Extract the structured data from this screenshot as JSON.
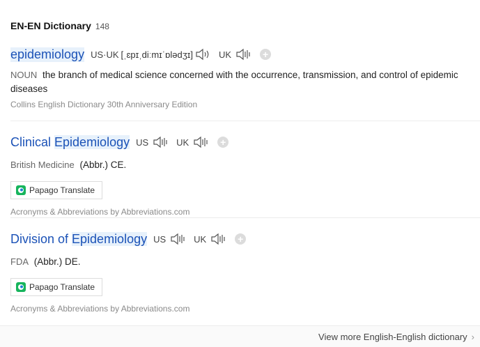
{
  "header": {
    "title": "EN-EN Dictionary",
    "count": "148"
  },
  "entries": [
    {
      "word": "epidemiology",
      "pron": [
        {
          "label": "US·UK",
          "ipa": "[ˌɛpɪˌdiːmɪˈɒlədʒɪ]"
        },
        {
          "label": "UK",
          "ipa": ""
        }
      ],
      "pos": "NOUN",
      "definition": "the branch of medical science concerned with the occurrence, transmission, and control of epidemic diseases",
      "source": "Collins English Dictionary 30th Anniversary Edition"
    },
    {
      "word_plain": "Clinical ",
      "word_highlight": "Epidemiology",
      "pron": [
        {
          "label": "US"
        },
        {
          "label": "UK"
        }
      ],
      "domain": "British Medicine",
      "abbr": "(Abbr.) CE.",
      "translate_label": "Papago Translate",
      "source": "Acronyms & Abbreviations by Abbreviations.com"
    },
    {
      "word_plain": "Division of ",
      "word_highlight": "Epidemiology",
      "pron": [
        {
          "label": "US"
        },
        {
          "label": "UK"
        }
      ],
      "domain": "FDA",
      "abbr": "(Abbr.) DE.",
      "translate_label": "Papago Translate",
      "source": "Acronyms & Abbreviations by Abbreviations.com"
    }
  ],
  "footer": {
    "more_label": "View more English-English dictionary"
  },
  "icons": {
    "speaker": "speaker-icon",
    "add": "plus-icon",
    "papago": "papago-logo-icon",
    "chevron": "chevron-right-icon"
  },
  "colors": {
    "link": "#1b52b7",
    "highlight": "#e7f1fb",
    "muted": "#8a8a8a"
  }
}
